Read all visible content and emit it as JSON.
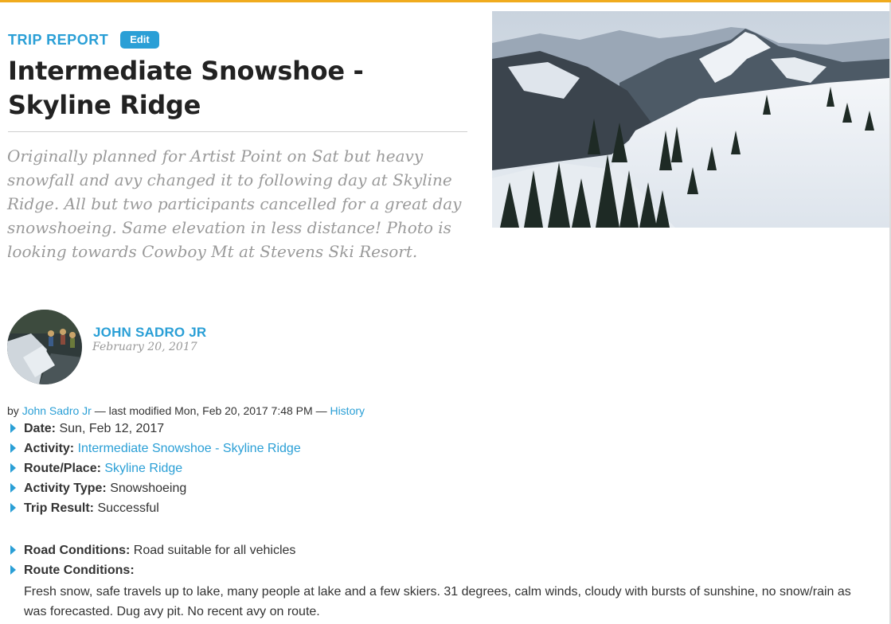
{
  "header": {
    "section_label": "TRIP REPORT",
    "edit_label": "Edit",
    "title": "Intermediate Snowshoe - Skyline Ridge",
    "description": "Originally planned for Artist Point on Sat but heavy snowfall and avy changed it to following day at Skyline Ridge. All but two participants cancelled for a great day snowshoeing. Same elevation in less distance! Photo is looking towards Cowboy Mt at Stevens Ski Resort."
  },
  "author": {
    "name": "JOHN SADRO JR",
    "date": "February 20, 2017"
  },
  "byline": {
    "prefix": "by",
    "author_link": "John Sadro Jr",
    "modified_text": "— last modified Mon, Feb 20, 2017 7:48 PM —",
    "history_link": "History"
  },
  "details": {
    "date_label": "Date:",
    "date_value": "Sun, Feb 12, 2017",
    "activity_label": "Activity:",
    "activity_value": "Intermediate Snowshoe - Skyline Ridge",
    "route_place_label": "Route/Place:",
    "route_place_value": "Skyline Ridge",
    "activity_type_label": "Activity Type:",
    "activity_type_value": "Snowshoeing",
    "trip_result_label": "Trip Result:",
    "trip_result_value": "Successful",
    "road_label": "Road Conditions:",
    "road_value": "Road suitable for all vehicles",
    "route_conditions_label": "Route Conditions:",
    "route_conditions_value": "Fresh snow, safe travels up to lake, many people at lake and a few skiers.  31 degrees, calm winds, cloudy with bursts of sunshine, no snow/rain as was forecasted.  Dug avy pit.  No recent avy on route."
  },
  "colors": {
    "accent": "#2a9fd6",
    "top_bar": "#f0ab1e",
    "title": "#222222",
    "muted": "#9a9a9a"
  },
  "icons": {
    "bullet": "triangle-right-icon"
  }
}
